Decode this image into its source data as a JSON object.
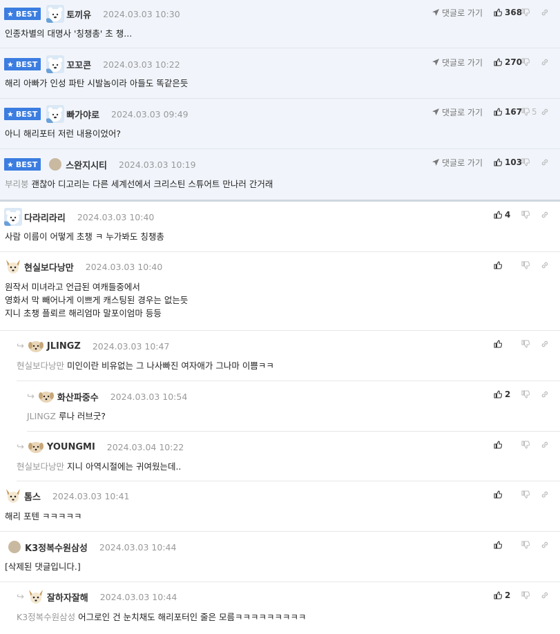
{
  "best_label": "BEST",
  "goto_label": "댓글로 가기",
  "comments": [
    {
      "nick": "토끼유",
      "date": "2024.03.03 10:30",
      "text": "인종차별의 대명사 '칭챙총' 초 챙...",
      "mention": "",
      "up": "368",
      "down": ""
    },
    {
      "nick": "꼬꼬콘",
      "date": "2024.03.03 10:22",
      "text": "해리 아빠가 인성 파탄 시발놈이라 아들도 똑같은듯",
      "mention": "",
      "up": "270",
      "down": ""
    },
    {
      "nick": "빠가야로",
      "date": "2024.03.03 09:49",
      "text": "아니 해리포터 저런 내용이었어?",
      "mention": "",
      "up": "167",
      "down": "5"
    },
    {
      "nick": "스완지시티",
      "date": "2024.03.03 10:19",
      "text": "괜찮아 디고리는 다른 세계선에서 크리스틴 스튜어트 만나러 간거래",
      "mention": "부리붕",
      "up": "103",
      "down": ""
    },
    {
      "nick": "다라리라리",
      "date": "2024.03.03 10:40",
      "text": "사람 이름이 어떻게 초챙 ㅋ 누가봐도 칭챙총",
      "mention": "",
      "up": "4",
      "down": ""
    },
    {
      "nick": "현실보다낭만",
      "date": "2024.03.03 10:40",
      "text_lines": [
        "원작서 미녀라고 언급된 여캐들중에서",
        "영화서 막 빼어나게 이쁘게 캐스팅된 경우는 없는듯",
        "지니 초챙 플뢰르 해리엄마 말포이엄마 등등"
      ],
      "up": "",
      "down": ""
    },
    {
      "nick": "JLINGZ",
      "date": "2024.03.03 10:47",
      "text": "미인이란 비유없는 그 나사빠진 여자애가 그나마 이쁨ㅋㅋ",
      "mention": "현실보다낭만",
      "up": "",
      "down": ""
    },
    {
      "nick": "화산파중수",
      "date": "2024.03.03 10:54",
      "text": "루나 러브굿?",
      "mention": "JLINGZ",
      "up": "2",
      "down": ""
    },
    {
      "nick": "YOUNGMI",
      "date": "2024.03.04 10:22",
      "text": "지니 아역시절에는 귀여웠는데..",
      "mention": "현실보다낭만",
      "up": "",
      "down": ""
    },
    {
      "nick": "톰스",
      "date": "2024.03.03 10:41",
      "text": "해리 포텐 ㅋㅋㅋㅋㅋ",
      "mention": "",
      "up": "",
      "down": ""
    },
    {
      "nick": "K3정복수원삼성",
      "date": "2024.03.03 10:44",
      "text": "[삭제된 댓글입니다.]",
      "mention": "",
      "up": "",
      "down": ""
    },
    {
      "nick": "잘하자잘해",
      "date": "2024.03.03 10:44",
      "text": "어그로인 건 눈치채도 해리포터인 줄은 모름ㅋㅋㅋㅋㅋㅋㅋㅋㅋ",
      "mention": "K3정복수원삼성",
      "up": "2",
      "down": ""
    }
  ],
  "icons": {
    "star": "star-icon",
    "goto": "send-arrow-icon",
    "up": "thumbs-up-icon",
    "down": "thumbs-down-icon",
    "link": "link-icon",
    "reply": "reply-arrow-icon"
  },
  "colors": {
    "best_badge": "#3b7de0",
    "best_row_bg": "#f1f5fb",
    "muted": "#999999"
  }
}
